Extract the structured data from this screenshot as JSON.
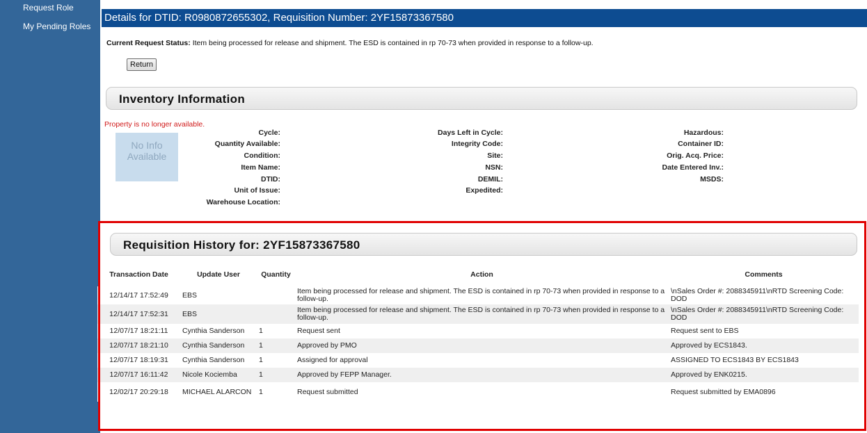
{
  "sidebar": {
    "items": [
      {
        "label": "Request Role"
      },
      {
        "label": "My Pending Roles"
      }
    ]
  },
  "header": {
    "title": "Details for DTID: R0980872655302, Requisition Number: 2YF15873367580"
  },
  "status": {
    "label": "Current Request Status:",
    "text": "Item being processed for release and shipment. The ESD is contained in rp 70-73 when provided in response to a follow-up."
  },
  "return_button": {
    "label": "Return"
  },
  "inventory": {
    "title": "Inventory Information",
    "availability_message": "Property is no longer available.",
    "image_placeholder": "No Info Available",
    "column1": [
      "Cycle:",
      "Quantity Available:",
      "Condition:",
      "Item Name:",
      "DTID:",
      "Unit of Issue:",
      "Warehouse Location:"
    ],
    "column2": [
      "Days Left in Cycle:",
      "Integrity Code:",
      "Site:",
      "NSN:",
      "DEMIL:",
      "Expedited:"
    ],
    "column3": [
      "Hazardous:",
      "Container ID:",
      "Orig. Acq. Price:",
      "Date Entered Inv.:",
      "MSDS:"
    ]
  },
  "history": {
    "title": "Requisition History for: 2YF15873367580",
    "columns": [
      "Transaction Date",
      "Update User",
      "Quantity",
      "Action",
      "Comments"
    ],
    "rows": [
      {
        "date": "12/14/17 17:52:49",
        "user": "EBS",
        "quantity": "",
        "action": "Item being processed for release and shipment. The ESD is contained in rp 70-73 when provided in response to a follow-up.",
        "comments": "\\nSales Order #: 2088345911\\nRTD Screening Code: DOD"
      },
      {
        "date": "12/14/17 17:52:31",
        "user": "EBS",
        "quantity": "",
        "action": "Item being processed for release and shipment. The ESD is contained in rp 70-73 when provided in response to a follow-up.",
        "comments": "\\nSales Order #: 2088345911\\nRTD Screening Code: DOD"
      },
      {
        "date": "12/07/17 18:21:11",
        "user": "Cynthia Sanderson",
        "quantity": "1",
        "action": "Request sent",
        "comments": "Request sent to EBS"
      },
      {
        "date": "12/07/17 18:21:10",
        "user": "Cynthia Sanderson",
        "quantity": "1",
        "action": "Approved by PMO",
        "comments": "Approved by ECS1843."
      },
      {
        "date": "12/07/17 18:19:31",
        "user": "Cynthia Sanderson",
        "quantity": "1",
        "action": "Assigned for approval",
        "comments": "ASSIGNED TO ECS1843 BY ECS1843"
      },
      {
        "date": "12/07/17 16:11:42",
        "user": "Nicole Kociemba",
        "quantity": "1",
        "action": "Approved by FEPP Manager.",
        "comments": "Approved by ENK0215."
      },
      {
        "date": "12/02/17 20:29:18",
        "user": "MICHAEL ALARCON",
        "quantity": "1",
        "action": "Request submitted",
        "comments": "Request submitted by EMA0896"
      }
    ]
  },
  "colors": {
    "sidebar": "#336699",
    "header": "#0d4c91",
    "highlight": "#e00000",
    "alert": "#d01818"
  }
}
